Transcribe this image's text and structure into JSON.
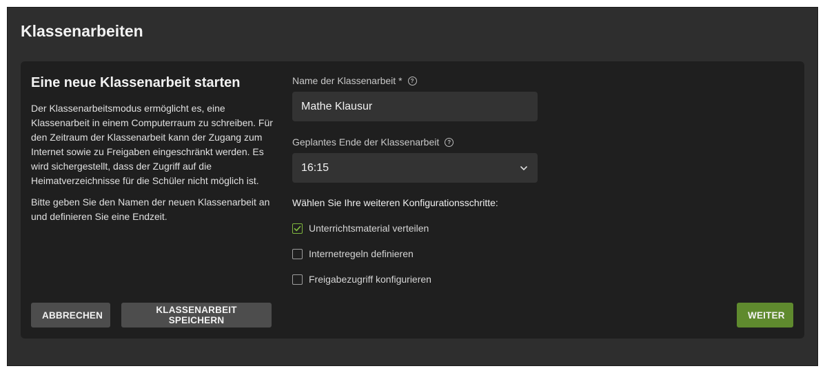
{
  "page": {
    "title": "Klassenarbeiten"
  },
  "card": {
    "title": "Eine neue Klassenarbeit starten",
    "description_1": "Der Klassenarbeitsmodus ermöglicht es, eine Klassenarbeit in einem Computerraum zu schreiben. Für den Zeitraum der Klassenarbeit kann der Zugang zum Internet sowie zu Freigaben eingeschränkt werden. Es wird sichergestellt, dass der Zugriff auf die Heimatverzeichnisse für die Schüler nicht möglich ist.",
    "description_2": "Bitte geben Sie den Namen der neuen Klassenarbeit an und definieren Sie eine Endzeit."
  },
  "form": {
    "name_label": "Name der Klassenarbeit *",
    "name_value": "Mathe Klausur",
    "end_label": "Geplantes Ende der Klassenarbeit",
    "end_value": "16:15",
    "config_label": "Wählen Sie Ihre weiteren Konfigurationsschritte:",
    "options": [
      {
        "label": "Unterrichtsmaterial verteilen",
        "checked": true
      },
      {
        "label": "Internetregeln definieren",
        "checked": false
      },
      {
        "label": "Freigabezugriff konfigurieren",
        "checked": false
      }
    ]
  },
  "buttons": {
    "cancel": "ABBRECHEN",
    "save": "KLASSENARBEIT SPEICHERN",
    "next": "WEITER"
  },
  "icons": {
    "help": "help-circle-icon",
    "chevron": "chevron-down-icon",
    "check": "check-icon"
  },
  "colors": {
    "accent": "#7fb83e",
    "primary_button": "#5f8a2e",
    "background": "#2e2e2e",
    "card": "#1f1f1f"
  }
}
